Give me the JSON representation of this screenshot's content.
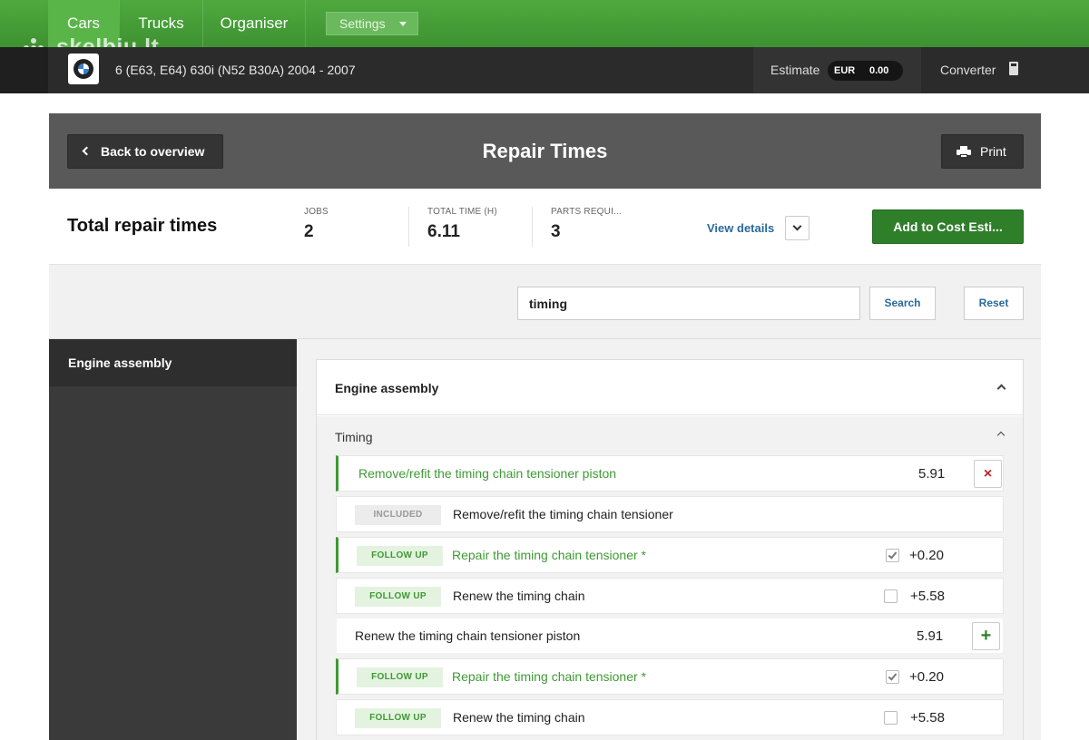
{
  "watermark": "skelbiu.lt",
  "topnav": {
    "tabs": [
      {
        "label": "Cars"
      },
      {
        "label": "Trucks"
      },
      {
        "label": "Organiser"
      }
    ],
    "settings_label": "Settings"
  },
  "vehicle": {
    "name": "6 (E63, E64) 630i (N52 B30A) 2004 - 2007",
    "estimate_label": "Estimate",
    "estimate_currency": "EUR",
    "estimate_amount": "0.00",
    "converter_label": "Converter"
  },
  "header": {
    "back_label": "Back to overview",
    "title": "Repair Times",
    "print_label": "Print"
  },
  "summary": {
    "title": "Total repair times",
    "stats": [
      {
        "label": "JOBS",
        "value": "2"
      },
      {
        "label": "TOTAL TIME (H)",
        "value": "6.11"
      },
      {
        "label": "PARTS REQUI...",
        "value": "3"
      }
    ],
    "view_details_label": "View details",
    "add_cost_label": "Add to Cost Esti..."
  },
  "search": {
    "value": "timing",
    "search_label": "Search",
    "reset_label": "Reset"
  },
  "sidebar": {
    "items": [
      {
        "label": "Engine assembly"
      }
    ]
  },
  "section": {
    "title": "Engine assembly",
    "subsection_title": "Timing",
    "rows": [
      {
        "text": "Remove/refit the timing chain tensioner piston",
        "time": "5.91"
      },
      {
        "badge": "INCLUDED",
        "text": "Remove/refit the timing chain tensioner"
      },
      {
        "badge": "FOLLOW UP",
        "text": "Repair the timing chain tensioner *",
        "time": "+0.20",
        "checked": true
      },
      {
        "badge": "FOLLOW UP",
        "text": "Renew the timing chain",
        "time": "+5.58",
        "checked": false
      },
      {
        "text": "Renew the timing chain tensioner piston",
        "time": "5.91"
      },
      {
        "badge": "FOLLOW UP",
        "text": "Repair the timing chain tensioner *",
        "time": "+0.20",
        "checked": true
      },
      {
        "badge": "FOLLOW UP",
        "text": "Renew the timing chain",
        "time": "+5.58",
        "checked": false
      }
    ]
  },
  "icons": {
    "remove": "×",
    "add": "+"
  },
  "colors": {
    "nav_green": "#4ea93e",
    "accent_green": "#3e9a33",
    "link_blue": "#2b6a9b",
    "remove_red": "#c0202a"
  }
}
